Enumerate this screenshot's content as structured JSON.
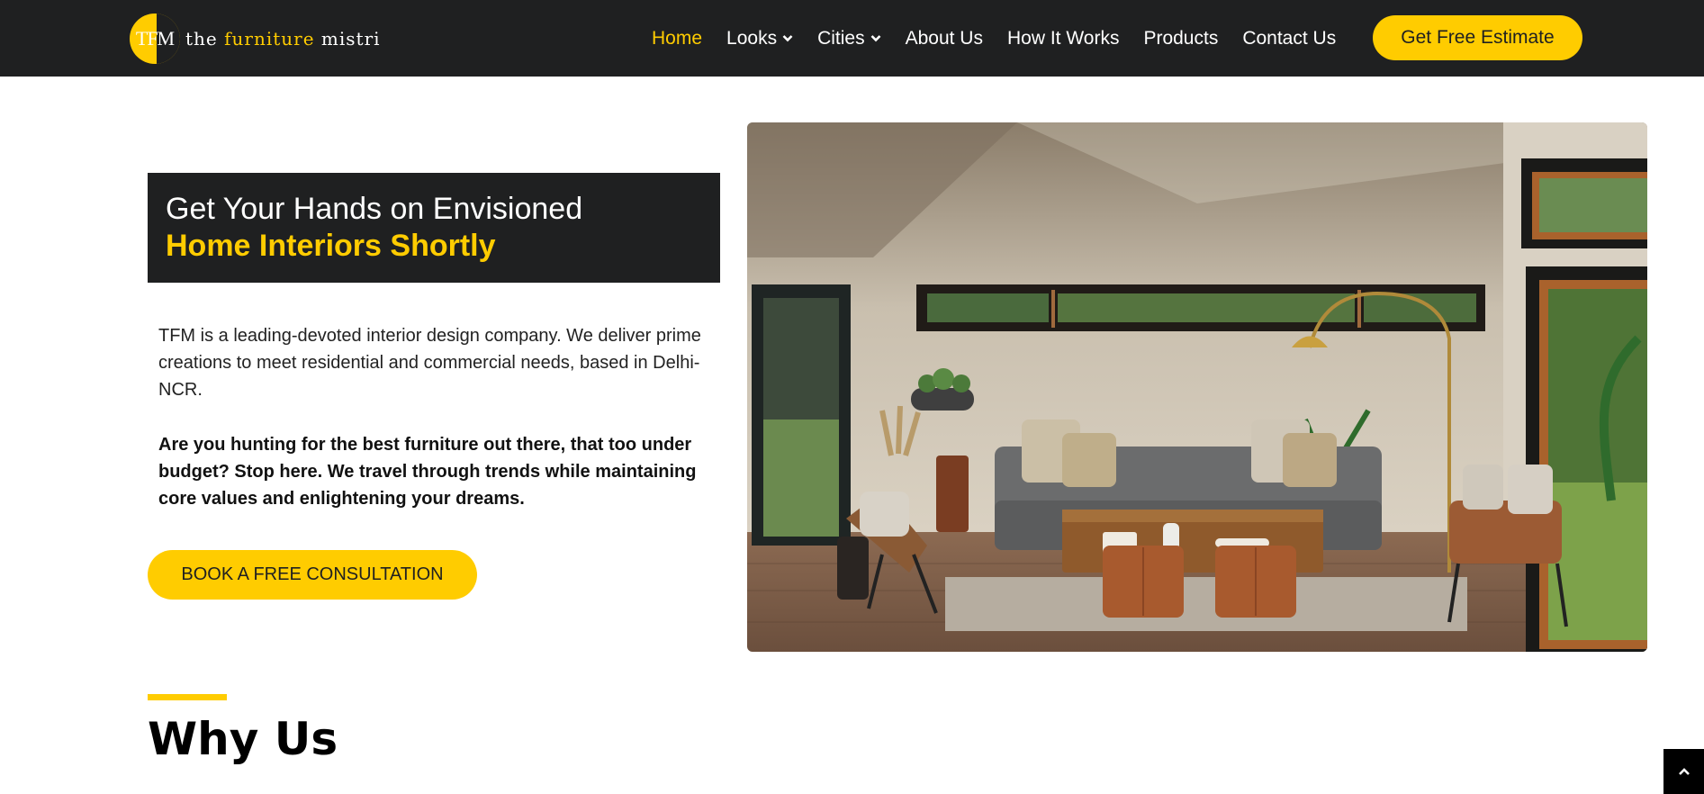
{
  "brand": {
    "logo_initials": "TFM",
    "name_part1": "the ",
    "name_accent": "furniture",
    "name_part2": " mistri"
  },
  "nav": {
    "items": [
      {
        "label": "Home",
        "active": true
      },
      {
        "label": "Looks",
        "dropdown": true
      },
      {
        "label": "Cities",
        "dropdown": true
      },
      {
        "label": "About Us"
      },
      {
        "label": "How It Works"
      },
      {
        "label": "Products"
      },
      {
        "label": "Contact Us"
      }
    ],
    "cta": "Get Free Estimate"
  },
  "hero": {
    "heading_line1": "Get Your Hands on Envisioned",
    "heading_line2": "Home Interiors Shortly",
    "intro": "TFM is a leading-devoted interior design company. We deliver prime creations to meet residential and commercial needs, based in Delhi-NCR.",
    "pitch": "Are you hunting for the best furniture out there, that too under budget? Stop here. We travel through trends while maintaining core values and enlightening your dreams.",
    "cta": "BOOK A FREE CONSULTATION"
  },
  "why": {
    "title": "Why Us"
  },
  "colors": {
    "accent": "#ffcc00",
    "dark": "#1f2021"
  },
  "icons": {
    "nav_dropdown": "chevron-down-icon",
    "scroll_top": "chevron-up-icon"
  }
}
